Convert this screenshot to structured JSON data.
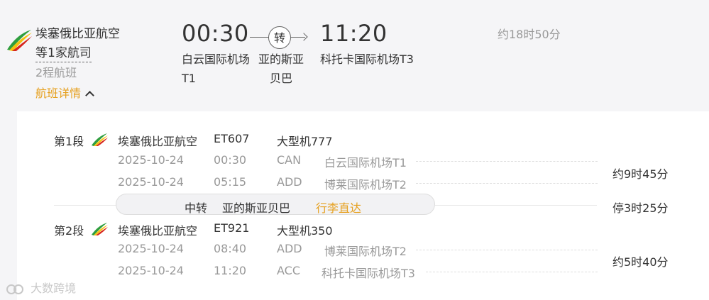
{
  "header": {
    "airline_name": "埃塞俄比亚航空",
    "airline_more": "等1家航司",
    "segments_count": "2程航班",
    "details_link": "航班详情",
    "departure_time": "00:30",
    "departure_airport": "白云国际机场T1",
    "transfer_badge": "转",
    "transfer_city": "亚的斯亚贝巴",
    "arrival_time": "11:20",
    "arrival_airport": "科托卡国际机场T3",
    "total_duration": "约18时50分"
  },
  "segments": [
    {
      "label": "第1段",
      "airline": "埃塞俄比亚航空",
      "flight_no": "ET607",
      "aircraft": "大型机777",
      "departure": {
        "date": "2025-10-24",
        "time": "00:30",
        "code": "CAN",
        "airport": "白云国际机场T1"
      },
      "arrival": {
        "date": "2025-10-24",
        "time": "05:15",
        "code": "ADD",
        "airport": "博莱国际机场T2"
      },
      "duration": "约9时45分"
    },
    {
      "label": "第2段",
      "airline": "埃塞俄比亚航空",
      "flight_no": "ET921",
      "aircraft": "大型机350",
      "departure": {
        "date": "2025-10-24",
        "time": "08:40",
        "code": "ADD",
        "airport": "博莱国际机场T2"
      },
      "arrival": {
        "date": "2025-10-24",
        "time": "11:20",
        "code": "ACC",
        "airport": "科托卡国际机场T3"
      },
      "duration": "约5时40分"
    }
  ],
  "transfer": {
    "label": "中转",
    "city": "亚的斯亚贝巴",
    "baggage": "行李直达",
    "stop": "停3时25分"
  },
  "watermark": "大数跨境",
  "colors": {
    "accent": "#e6a01e",
    "logo_green": "#2e9e3e",
    "logo_yellow": "#f4c20d",
    "logo_red": "#d7261e",
    "background": "#f5f5f7",
    "panel": "#ffffff"
  }
}
